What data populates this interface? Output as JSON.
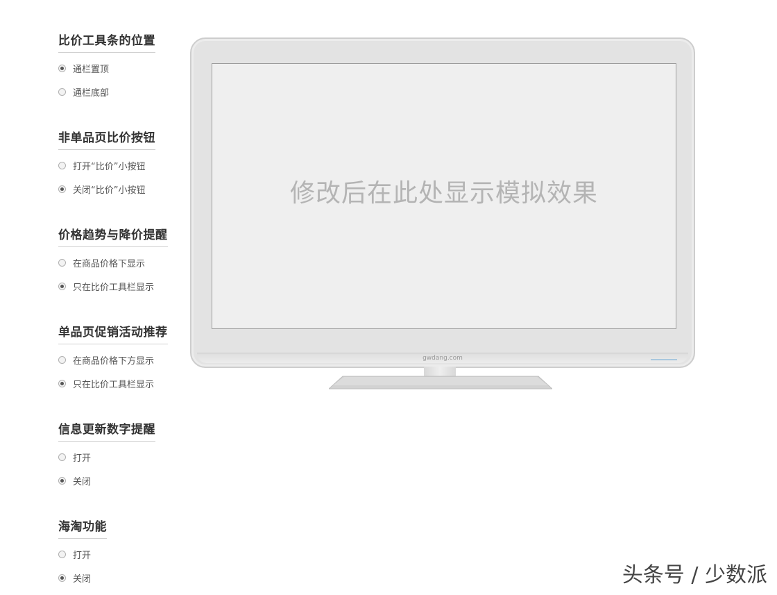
{
  "settings": {
    "toolbar_position": {
      "title": "比价工具条的位置",
      "options": [
        {
          "label": "通栏置顶",
          "checked": true
        },
        {
          "label": "通栏底部",
          "checked": false
        }
      ]
    },
    "nonproduct_button": {
      "title": "非单品页比价按钮",
      "options": [
        {
          "label": "打开“比价”小按钮",
          "checked": false
        },
        {
          "label": "关闭“比价”小按钮",
          "checked": true
        }
      ]
    },
    "price_trend": {
      "title": "价格趋势与降价提醒",
      "options": [
        {
          "label": "在商品价格下显示",
          "checked": false
        },
        {
          "label": "只在比价工具栏显示",
          "checked": true
        }
      ]
    },
    "promotion": {
      "title": "单品页促销活动推荐",
      "options": [
        {
          "label": "在商品价格下方显示",
          "checked": false
        },
        {
          "label": "只在比价工具栏显示",
          "checked": true
        }
      ]
    },
    "update_badge": {
      "title": "信息更新数字提醒",
      "options": [
        {
          "label": "打开",
          "checked": false
        },
        {
          "label": "关闭",
          "checked": true
        }
      ]
    },
    "haitao": {
      "title": "海淘功能",
      "options": [
        {
          "label": "打开",
          "checked": false
        },
        {
          "label": "关闭",
          "checked": true
        }
      ]
    }
  },
  "preview": {
    "message": "修改后在此处显示模拟效果",
    "brand": "gwdang.com"
  },
  "watermark": "头条号 / 少数派"
}
